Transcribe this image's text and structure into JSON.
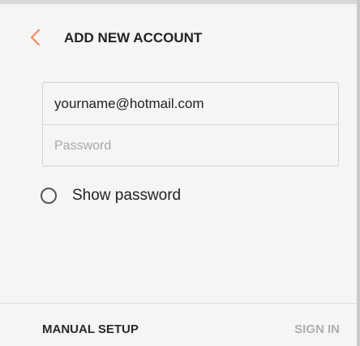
{
  "header": {
    "back_icon": "chevron-left-icon",
    "title": "ADD NEW ACCOUNT",
    "accent_color": "#f08a5d"
  },
  "form": {
    "email_value": "yourname@hotmail.com",
    "password_value": "",
    "password_placeholder": "Password"
  },
  "options": {
    "show_password_label": "Show password",
    "show_password_checked": false
  },
  "footer": {
    "manual_setup_label": "MANUAL SETUP",
    "sign_in_label": "SIGN IN",
    "sign_in_color": "#b0b0b0"
  }
}
